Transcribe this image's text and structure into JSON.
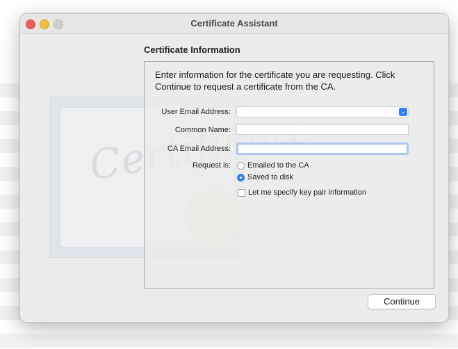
{
  "window": {
    "title": "Certificate Assistant"
  },
  "illustration": {
    "word": "Certificate"
  },
  "section": {
    "heading": "Certificate Information",
    "intro": "Enter information for the certificate you are requesting. Click Continue to request a certificate from the CA."
  },
  "form": {
    "user_email": {
      "label": "User Email Address:",
      "value": ""
    },
    "common_name": {
      "label": "Common Name:",
      "value": ""
    },
    "ca_email": {
      "label": "CA Email Address:",
      "value": ""
    },
    "request_is": {
      "label": "Request is:",
      "options": [
        "Emailed to the CA",
        "Saved to disk"
      ],
      "selected": "Saved to disk"
    },
    "key_pair": {
      "label": "Let me specify key pair information",
      "checked": false
    }
  },
  "buttons": {
    "continue": "Continue"
  },
  "icons": {
    "combo_arrow": "chevron-down-icon"
  }
}
